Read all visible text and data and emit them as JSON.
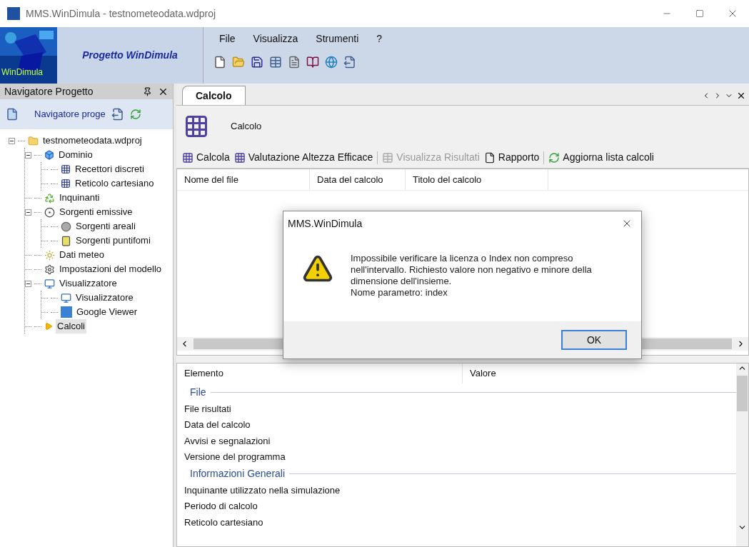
{
  "window": {
    "title": "MMS.WinDimula - testnometeodata.wdproj"
  },
  "logo": {
    "caption": "WinDimula",
    "project_title": "Progetto WinDimula"
  },
  "menu": [
    "File",
    "Visualizza",
    "Strumenti",
    "?"
  ],
  "navigator": {
    "title": "Navigatore Progetto",
    "toolbar_label": "Navigatore proge",
    "tree": [
      {
        "label": "testnometeodata.wdproj",
        "expanded": true,
        "selected": false,
        "children": [
          {
            "label": "Dominio",
            "expanded": true,
            "selected": false,
            "children": [
              {
                "label": "Recettori discreti",
                "selected": false
              },
              {
                "label": "Reticolo cartesiano",
                "selected": false
              }
            ]
          },
          {
            "label": "Inquinanti",
            "selected": false
          },
          {
            "label": "Sorgenti emissive",
            "expanded": true,
            "selected": false,
            "children": [
              {
                "label": "Sorgenti areali",
                "selected": false
              },
              {
                "label": "Sorgenti puntifomi",
                "selected": false
              }
            ]
          },
          {
            "label": "Dati meteo",
            "selected": false
          },
          {
            "label": "Impostazioni del modello",
            "selected": false
          },
          {
            "label": "Visualizzatore",
            "expanded": true,
            "selected": false,
            "children": [
              {
                "label": "Visualizzatore",
                "selected": false
              },
              {
                "label": "Google Viewer",
                "selected": false
              }
            ]
          },
          {
            "label": "Calcoli",
            "selected": true
          }
        ]
      }
    ]
  },
  "document": {
    "tabs": [
      {
        "label": "Calcolo",
        "selected": true
      }
    ],
    "header": "Calcolo",
    "toolbar": [
      {
        "label": "Calcola",
        "disabled": false
      },
      {
        "label": "Valutazione Altezza Efficace",
        "disabled": false
      },
      {
        "label": "Visualizza Risultati",
        "disabled": true
      },
      {
        "label": "Rapporto",
        "disabled": false
      },
      {
        "label": "Aggiorna lista calcoli",
        "disabled": false
      }
    ],
    "table": {
      "columns": [
        "Nome del file",
        "Data del calcolo",
        "Titolo del calcolo"
      ]
    },
    "properties": {
      "columns": [
        "Elemento",
        "Valore"
      ],
      "categories": [
        {
          "name": "File",
          "rows": [
            "File risultati",
            "Data del calcolo",
            "Avvisi e segnalazioni",
            "Versione del programma"
          ]
        },
        {
          "name": "Informazioni Generali",
          "rows": [
            "Inquinante utilizzato nella simulazione",
            "Periodo di calcolo",
            "Reticolo cartesiano"
          ]
        }
      ]
    }
  },
  "dialog": {
    "title": "MMS.WinDimula",
    "message": [
      "Impossibile verificare la licenza o Index non compreso nell'intervallo. Richiesto valore non negativo e minore della dimensione dell'insieme.",
      "Nome parametro: index"
    ],
    "button": "OK"
  }
}
